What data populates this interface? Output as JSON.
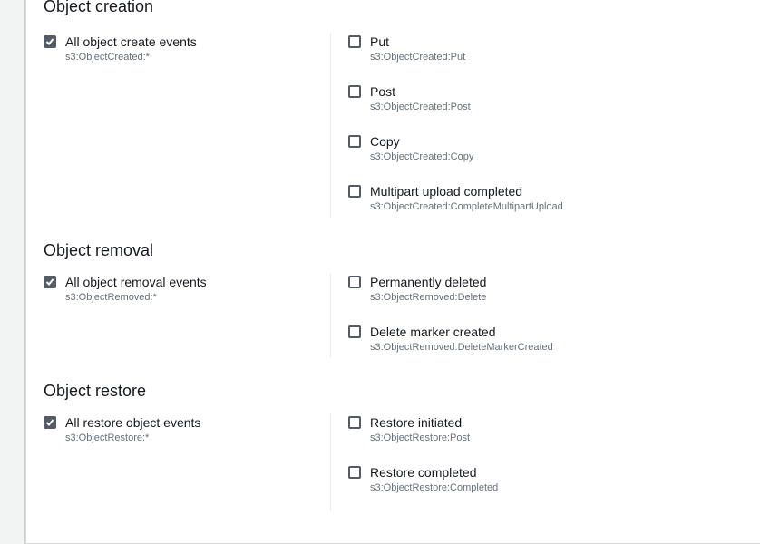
{
  "sections": [
    {
      "title": "Object creation",
      "all": {
        "label": "All object create events",
        "desc": "s3:ObjectCreated:*",
        "checked": true
      },
      "items": [
        {
          "label": "Put",
          "desc": "s3:ObjectCreated:Put",
          "checked": false
        },
        {
          "label": "Post",
          "desc": "s3:ObjectCreated:Post",
          "checked": false
        },
        {
          "label": "Copy",
          "desc": "s3:ObjectCreated:Copy",
          "checked": false
        },
        {
          "label": "Multipart upload completed",
          "desc": "s3:ObjectCreated:CompleteMultipartUpload",
          "checked": false
        }
      ]
    },
    {
      "title": "Object removal",
      "all": {
        "label": "All object removal events",
        "desc": "s3:ObjectRemoved:*",
        "checked": true
      },
      "items": [
        {
          "label": "Permanently deleted",
          "desc": "s3:ObjectRemoved:Delete",
          "checked": false
        },
        {
          "label": "Delete marker created",
          "desc": "s3:ObjectRemoved:DeleteMarkerCreated",
          "checked": false
        }
      ]
    },
    {
      "title": "Object restore",
      "all": {
        "label": "All restore object events",
        "desc": "s3:ObjectRestore:*",
        "checked": true
      },
      "items": [
        {
          "label": "Restore initiated",
          "desc": "s3:ObjectRestore:Post",
          "checked": false
        },
        {
          "label": "Restore completed",
          "desc": "s3:ObjectRestore:Completed",
          "checked": false
        }
      ]
    }
  ]
}
